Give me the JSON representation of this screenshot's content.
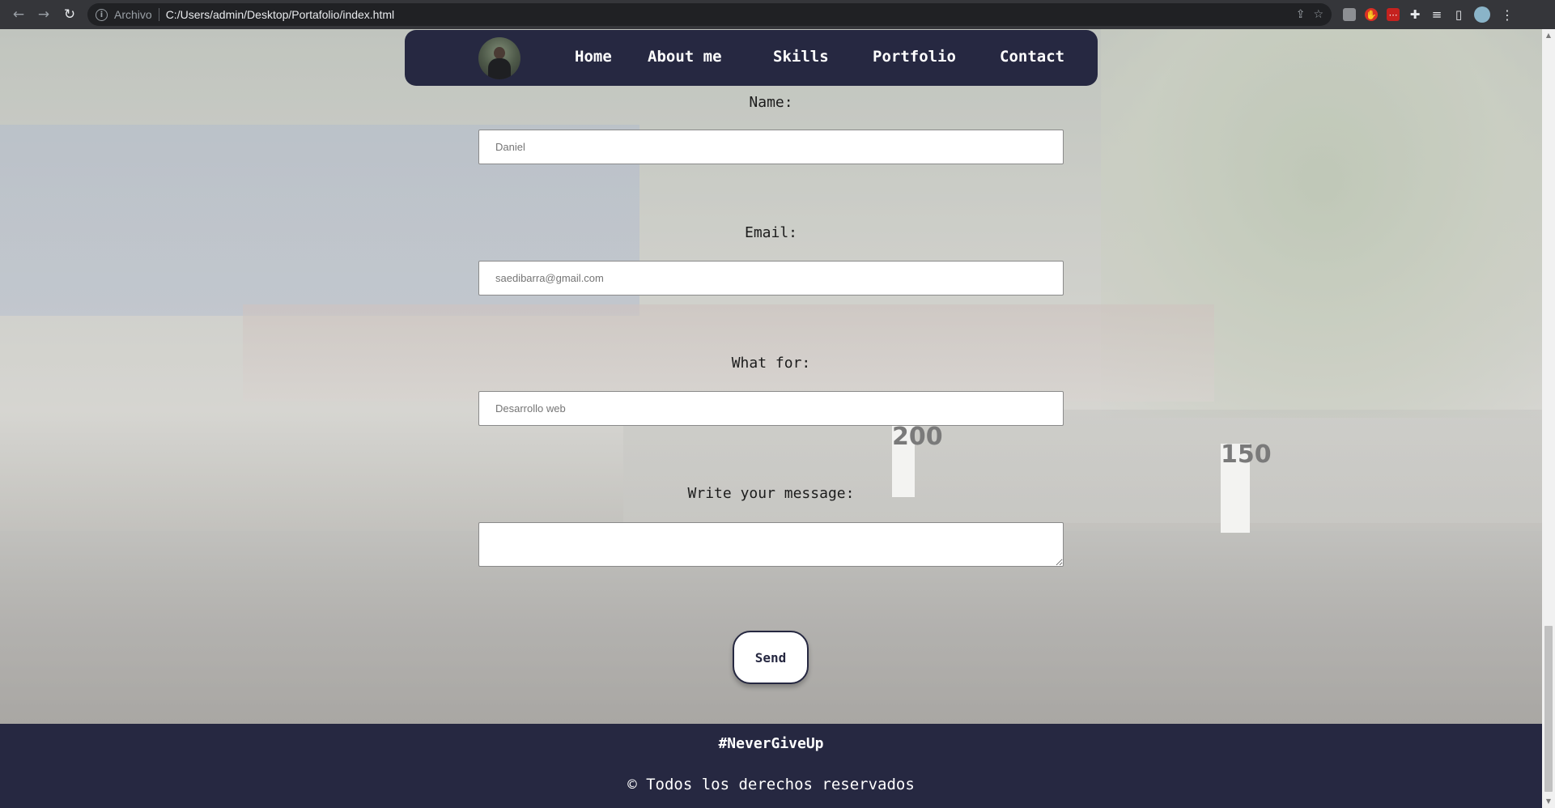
{
  "browser": {
    "scheme_label": "Archivo",
    "url": "C:/Users/admin/Desktop/Portafolio/index.html",
    "icons": [
      "back-icon",
      "forward-icon",
      "reload-icon",
      "info-icon",
      "share-icon",
      "star-icon",
      "extensions-icon",
      "reading-list-icon",
      "side-panel-icon",
      "profile-avatar",
      "menu-icon"
    ]
  },
  "nav": {
    "links": [
      {
        "label": "Home"
      },
      {
        "label": "About me"
      },
      {
        "label": "Skills"
      },
      {
        "label": "Portfolio"
      },
      {
        "label": "Contact"
      }
    ]
  },
  "form": {
    "name_label": "Name:",
    "name_placeholder": "Daniel",
    "email_label": "Email:",
    "email_placeholder": "saedibarra@gmail.com",
    "whatfor_label": "What for:",
    "whatfor_placeholder": "Desarrollo web",
    "message_label": "Write your message:",
    "message_value": "",
    "send_label": "Send"
  },
  "background": {
    "sign_200": "200",
    "sign_150": "150"
  },
  "footer": {
    "hashtag": "#NeverGiveUp",
    "copyright": "© Todos los derechos reservados"
  },
  "colors": {
    "navy": "#262841",
    "chrome": "#35363a"
  }
}
